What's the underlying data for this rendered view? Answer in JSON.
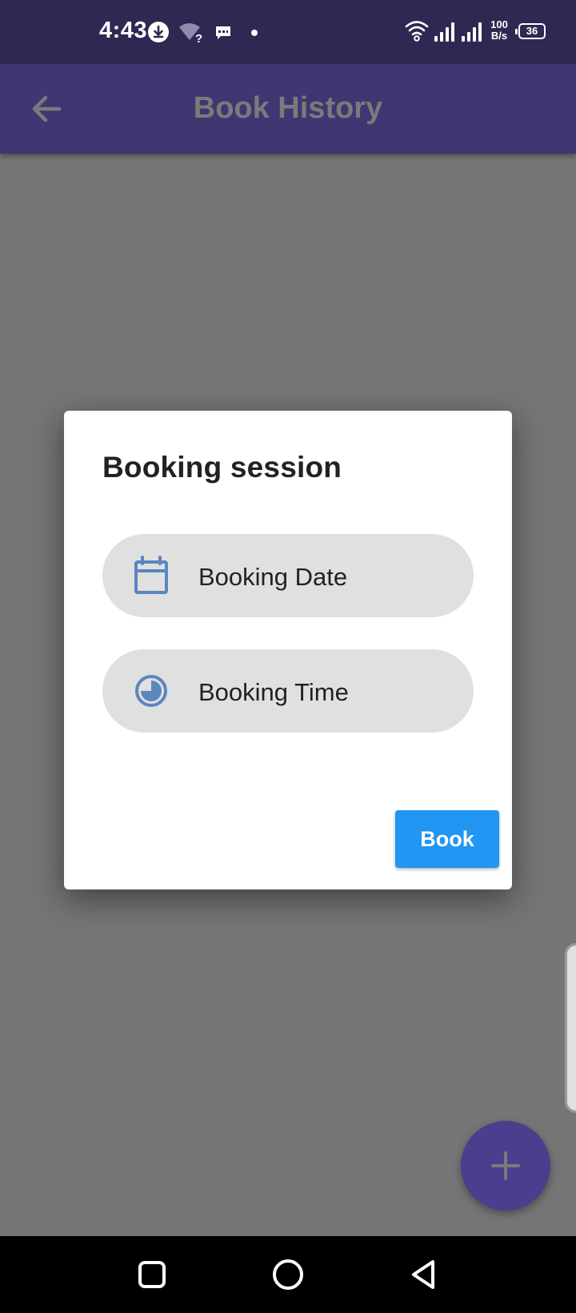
{
  "status_bar": {
    "time": "4:43",
    "net_speed_value": "100",
    "net_speed_unit": "B/s",
    "battery": "36",
    "icons": [
      "download-icon",
      "wifi-unknown-icon",
      "message-icon",
      "dot-icon",
      "wifi-icon",
      "signal-icon",
      "signal-icon-2",
      "battery-icon"
    ]
  },
  "app_bar": {
    "title": "Book History",
    "back_icon": "arrow-back-icon",
    "background": "#3f3672"
  },
  "dialog": {
    "title": "Booking session",
    "date_button_label": "Booking Date",
    "date_icon": "calendar-icon",
    "time_button_label": "Booking Time",
    "time_icon": "clock-icon",
    "book_button_label": "Book",
    "accent": "#2196f3",
    "icon_color": "#5b86c0"
  },
  "fab": {
    "icon": "plus-icon",
    "background": "#4a3f8e"
  },
  "nav_bar": {
    "items": [
      "recents-button",
      "home-button",
      "back-button"
    ]
  }
}
